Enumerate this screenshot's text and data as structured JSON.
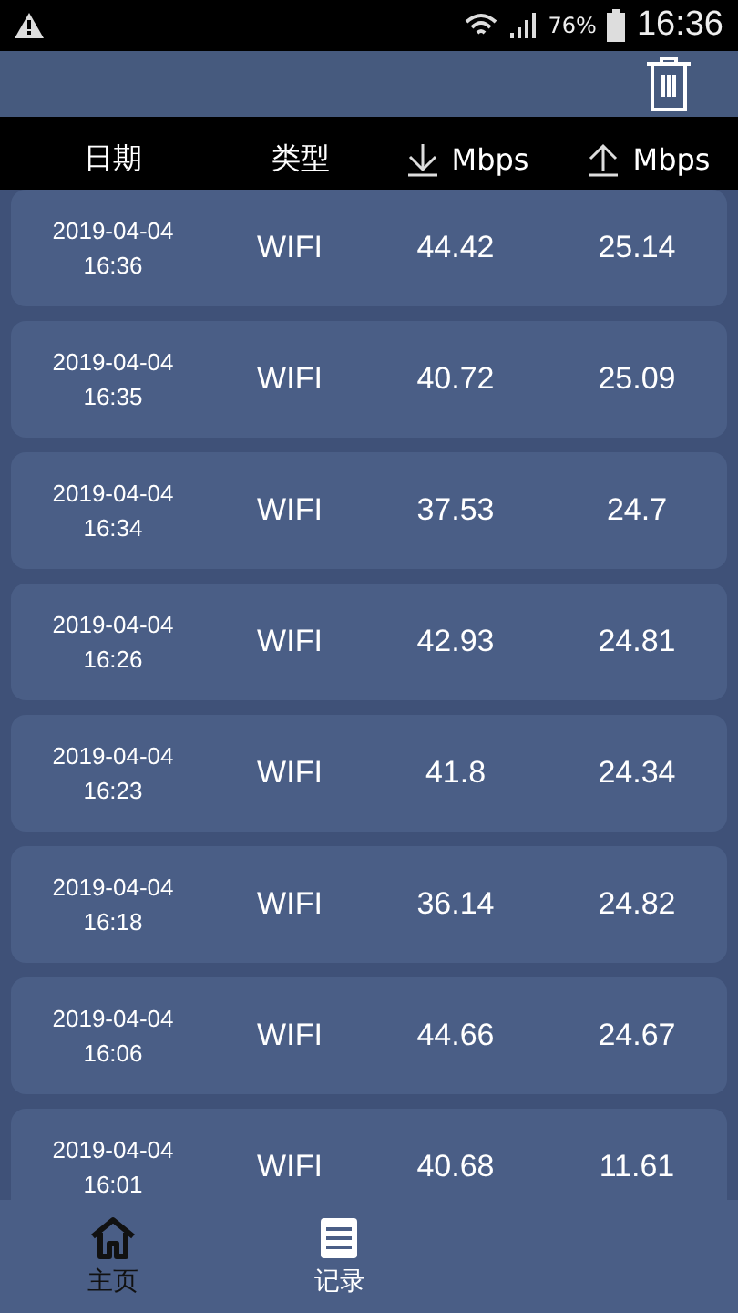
{
  "status_bar": {
    "battery": "76%",
    "time": "16:36"
  },
  "header": {
    "columns": [
      "日期",
      "类型",
      "Mbps",
      "Mbps"
    ]
  },
  "records": [
    {
      "date": "2019-04-04",
      "time": "16:36",
      "type": "WIFI",
      "download": "44.42",
      "upload": "25.14"
    },
    {
      "date": "2019-04-04",
      "time": "16:35",
      "type": "WIFI",
      "download": "40.72",
      "upload": "25.09"
    },
    {
      "date": "2019-04-04",
      "time": "16:34",
      "type": "WIFI",
      "download": "37.53",
      "upload": "24.7"
    },
    {
      "date": "2019-04-04",
      "time": "16:26",
      "type": "WIFI",
      "download": "42.93",
      "upload": "24.81"
    },
    {
      "date": "2019-04-04",
      "time": "16:23",
      "type": "WIFI",
      "download": "41.8",
      "upload": "24.34"
    },
    {
      "date": "2019-04-04",
      "time": "16:18",
      "type": "WIFI",
      "download": "36.14",
      "upload": "24.82"
    },
    {
      "date": "2019-04-04",
      "time": "16:06",
      "type": "WIFI",
      "download": "44.66",
      "upload": "24.67"
    },
    {
      "date": "2019-04-04",
      "time": "16:01",
      "type": "WIFI",
      "download": "40.68",
      "upload": "11.61"
    }
  ],
  "nav": [
    {
      "label": "主页",
      "kind": "home",
      "selected": false
    },
    {
      "label": "记录",
      "kind": "records",
      "selected": true
    }
  ]
}
